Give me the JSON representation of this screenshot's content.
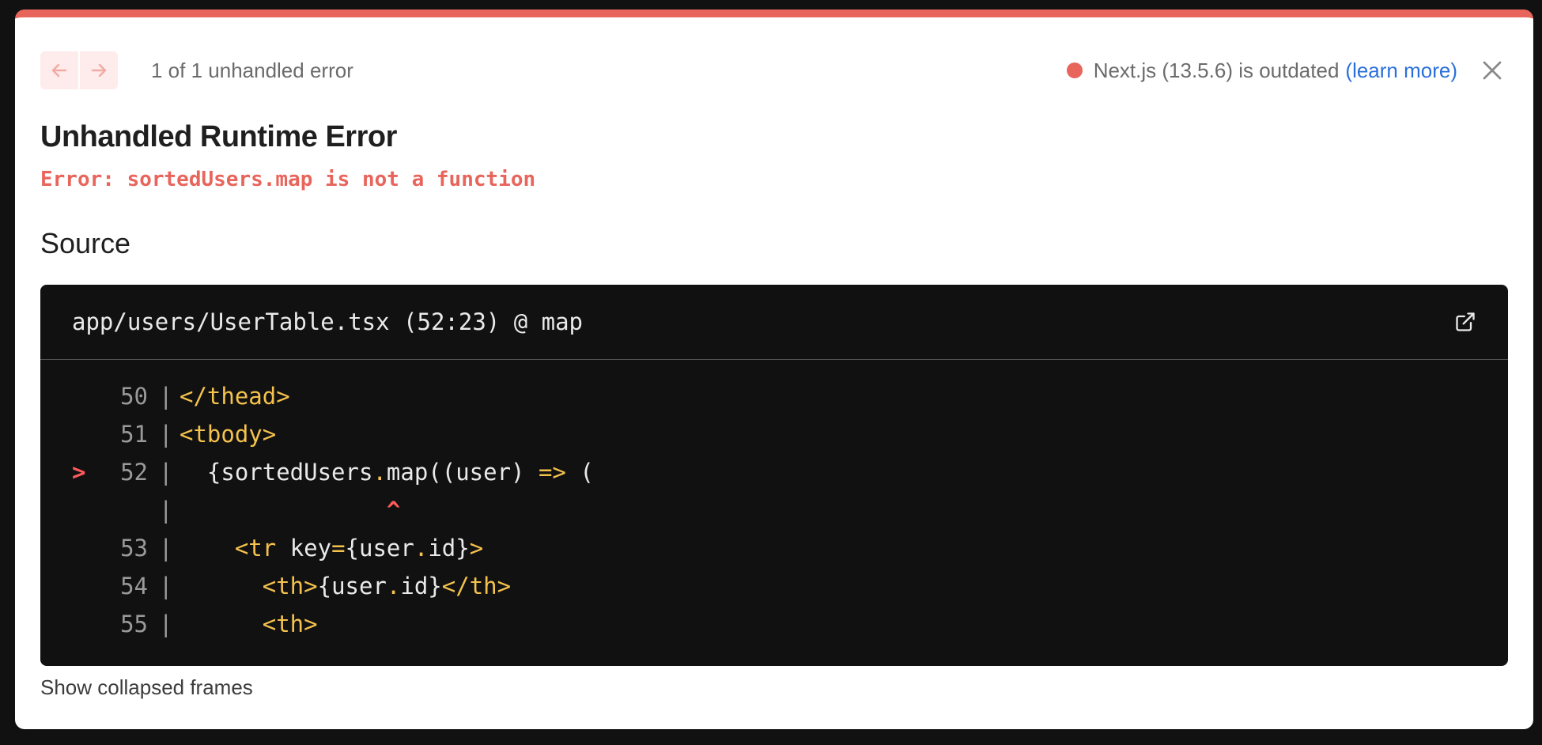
{
  "nav": {
    "prev_icon": "arrow-left-icon",
    "next_icon": "arrow-right-icon",
    "counter": "1 of 1 unhandled error"
  },
  "version": {
    "status_color": "#e8655c",
    "text": "Next.js (13.5.6) is outdated",
    "link": "(learn more)"
  },
  "close_icon": "close-icon",
  "error": {
    "title": "Unhandled Runtime Error",
    "message": "Error: sortedUsers.map is not a function"
  },
  "source": {
    "heading": "Source",
    "file": "app/users/UserTable.tsx (52:23) @ map",
    "open_icon": "external-link-icon",
    "lines": [
      {
        "num": "50",
        "marker": "",
        "segments": [
          {
            "t": "</thead>",
            "c": "tag"
          }
        ]
      },
      {
        "num": "51",
        "marker": "",
        "segments": [
          {
            "t": "<tbody>",
            "c": "tag"
          }
        ]
      },
      {
        "num": "52",
        "marker": ">",
        "segments": [
          {
            "t": "  {sortedUsers",
            "c": "plain"
          },
          {
            "t": ".",
            "c": "punc"
          },
          {
            "t": "map((user) ",
            "c": "plain"
          },
          {
            "t": "=>",
            "c": "punc"
          },
          {
            "t": " (",
            "c": "plain"
          }
        ]
      },
      {
        "num": "",
        "marker": "",
        "caret": "               ^",
        "segments": []
      },
      {
        "num": "53",
        "marker": "",
        "segments": [
          {
            "t": "    ",
            "c": "plain"
          },
          {
            "t": "<tr",
            "c": "tag"
          },
          {
            "t": " key",
            "c": "plain"
          },
          {
            "t": "=",
            "c": "punc"
          },
          {
            "t": "{user",
            "c": "plain"
          },
          {
            "t": ".",
            "c": "punc"
          },
          {
            "t": "id}",
            "c": "plain"
          },
          {
            "t": ">",
            "c": "tag"
          }
        ]
      },
      {
        "num": "54",
        "marker": "",
        "segments": [
          {
            "t": "      ",
            "c": "plain"
          },
          {
            "t": "<th>",
            "c": "tag"
          },
          {
            "t": "{user",
            "c": "plain"
          },
          {
            "t": ".",
            "c": "punc"
          },
          {
            "t": "id}",
            "c": "plain"
          },
          {
            "t": "</th>",
            "c": "tag"
          }
        ]
      },
      {
        "num": "55",
        "marker": "",
        "segments": [
          {
            "t": "      ",
            "c": "plain"
          },
          {
            "t": "<th>",
            "c": "tag"
          }
        ]
      }
    ]
  },
  "footer": {
    "show_frames": "Show collapsed frames"
  }
}
